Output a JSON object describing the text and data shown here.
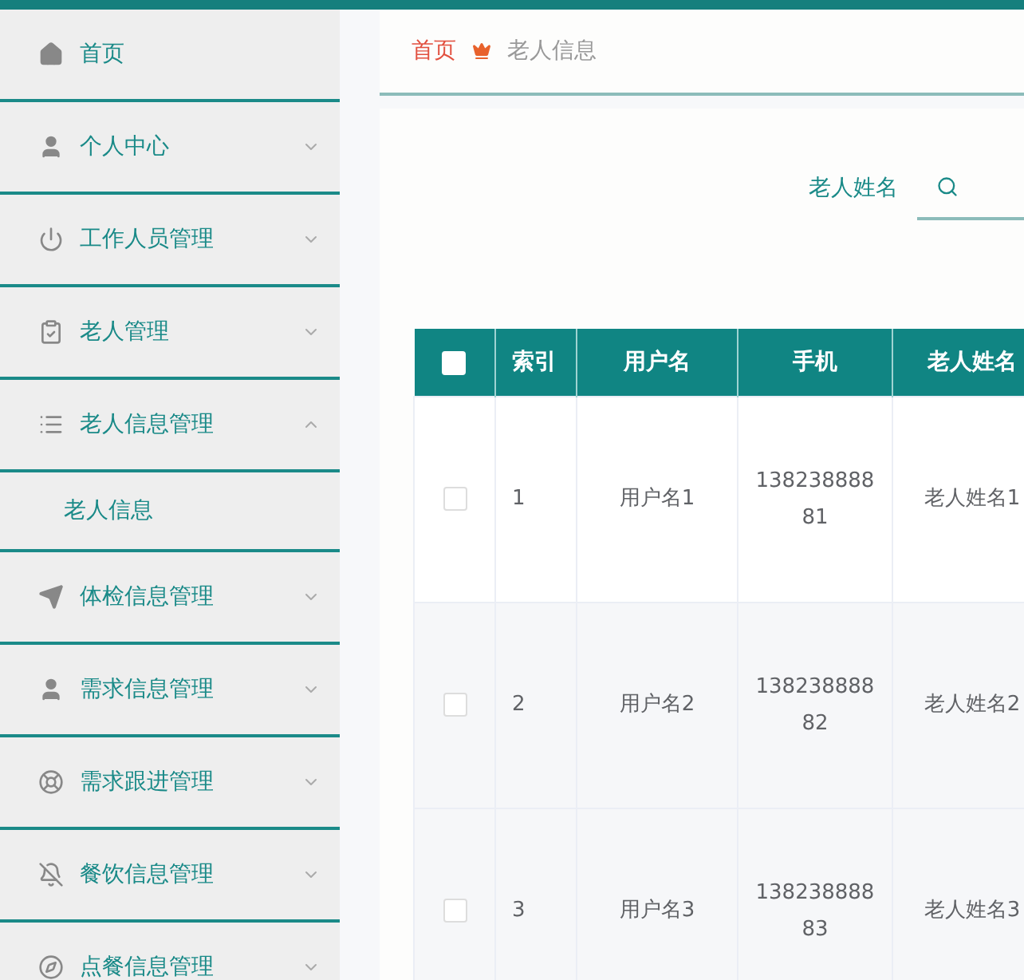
{
  "sidebar": {
    "items": [
      {
        "label": "首页",
        "kind": "link"
      },
      {
        "label": "个人中心",
        "kind": "menu",
        "expanded": false
      },
      {
        "label": "工作人员管理",
        "kind": "menu",
        "expanded": false
      },
      {
        "label": "老人管理",
        "kind": "menu",
        "expanded": false
      },
      {
        "label": "老人信息管理",
        "kind": "menu",
        "expanded": true,
        "children": [
          {
            "label": "老人信息"
          }
        ]
      },
      {
        "label": "体检信息管理",
        "kind": "menu",
        "expanded": false
      },
      {
        "label": "需求信息管理",
        "kind": "menu",
        "expanded": false
      },
      {
        "label": "需求跟进管理",
        "kind": "menu",
        "expanded": false
      },
      {
        "label": "餐饮信息管理",
        "kind": "menu",
        "expanded": false
      },
      {
        "label": "点餐信息管理",
        "kind": "menu",
        "expanded": false
      }
    ]
  },
  "breadcrumb": [
    "首页",
    "老人信息"
  ],
  "search": {
    "label": "老人姓名"
  },
  "table": {
    "select_all_checked": false,
    "columns": [
      "索引",
      "用户名",
      "手机",
      "老人姓名"
    ],
    "rows": [
      {
        "checked": false,
        "cells": [
          "1",
          "用户名1",
          "13823888881",
          "老人姓名1"
        ]
      },
      {
        "checked": false,
        "cells": [
          "2",
          "用户名2",
          "13823888882",
          "老人姓名2"
        ]
      },
      {
        "checked": false,
        "cells": [
          "3",
          "用户名3",
          "13823888883",
          "老人姓名3"
        ]
      }
    ]
  }
}
